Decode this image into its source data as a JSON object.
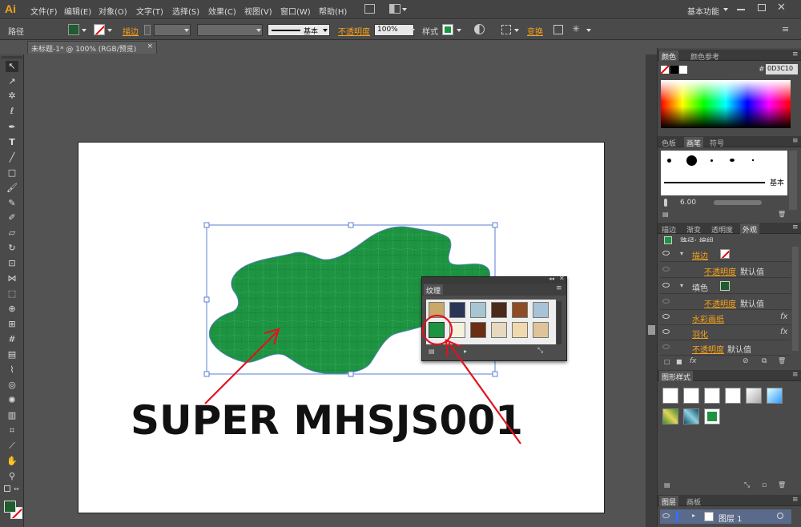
{
  "app": {
    "logo": "Ai"
  },
  "menu": [
    "文件(F)",
    "编辑(E)",
    "对象(O)",
    "文字(T)",
    "选择(S)",
    "效果(C)",
    "视图(V)",
    "窗口(W)",
    "帮助(H)"
  ],
  "workspace": "基本功能",
  "control": {
    "selection": "路径",
    "stroke_label": "描边",
    "brush_name": "基本",
    "opacity_label": "不透明度",
    "opacity_value": "100%",
    "style_label": "样式",
    "transform_label": "变换",
    "fill_color": "#1f5c2e",
    "accent": "#f7a21b"
  },
  "document_tab": {
    "title": "未标题-1* @ 100% (RGB/预览)",
    "close": "×"
  },
  "artwork": {
    "text": "SUPER MHSJS001",
    "shape_color": "#1e9442"
  },
  "texture_panel": {
    "title": "纹理"
  },
  "color_panel": {
    "tabs": [
      "颜色",
      "颜色参考"
    ],
    "hex_prefix": "#",
    "hex": "0D3C10"
  },
  "brush_panel": {
    "tabs": [
      "色板",
      "画笔",
      "符号"
    ],
    "basic_label": "基本",
    "size": "6.00"
  },
  "appearance_panel": {
    "tabs": [
      "描边",
      "渐变",
      "透明度",
      "外观"
    ],
    "header": "路径: 编组",
    "rows": [
      {
        "label": "描边",
        "value": ""
      },
      {
        "label": "不透明度",
        "value": "默认值"
      },
      {
        "label": "填色",
        "value": ""
      },
      {
        "label": "不透明度",
        "value": "默认值"
      },
      {
        "label": "水彩画纸",
        "value": "fx"
      },
      {
        "label": "羽化",
        "value": "fx"
      },
      {
        "label": "不透明度",
        "value": "默认值"
      }
    ]
  },
  "graphic_styles": {
    "title": "图形样式"
  },
  "layers": {
    "tabs": [
      "图层",
      "画板"
    ],
    "layer_name": "图层 1"
  }
}
